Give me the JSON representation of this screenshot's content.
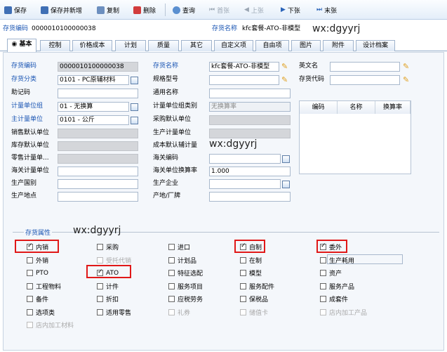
{
  "toolbar": {
    "items": [
      {
        "name": "save-button",
        "label": "保存",
        "icon": "save-icon",
        "enabled": true
      },
      {
        "name": "save-new-button",
        "label": "保存并新增",
        "icon": "save-new-icon",
        "enabled": true
      },
      {
        "name": "copy-button",
        "label": "复制",
        "icon": "copy-icon",
        "enabled": true
      },
      {
        "name": "delete-button",
        "label": "删除",
        "icon": "delete-icon",
        "enabled": true
      },
      {
        "name": "query-button",
        "label": "查询",
        "icon": "query-icon",
        "enabled": true
      },
      {
        "name": "first-button",
        "label": "首张",
        "icon": "first-icon",
        "enabled": false
      },
      {
        "name": "prev-button",
        "label": "上张",
        "icon": "prev-icon",
        "enabled": false
      },
      {
        "name": "next-button",
        "label": "下张",
        "icon": "next-icon",
        "enabled": true
      },
      {
        "name": "last-button",
        "label": "末张",
        "icon": "last-icon",
        "enabled": true
      }
    ]
  },
  "header": {
    "code_label": "存货编码",
    "code_value": "0000010100000038",
    "name_label": "存货名称",
    "name_value": "kfc套餐-ATO-非模型",
    "watermark": "wx:dgyyrj"
  },
  "tabs": [
    "基本",
    "控制",
    "价格成本",
    "计划",
    "质量",
    "其它",
    "自定义项",
    "自由项",
    "图片",
    "附件",
    "设计档案"
  ],
  "form": {
    "labels": {
      "code": "存货编码",
      "category": "存货分类",
      "mnemonic": "助记码",
      "uom_group": "计量单位组",
      "main_uom": "主计量单位",
      "sales_uom": "销售默认单位",
      "stock_uom": "库存默认单位",
      "retail_uom": "零售计量单...",
      "customs_uom": "海关计量单位",
      "origin_country": "生产国别",
      "origin_place": "生产地点",
      "name": "存货名称",
      "spec": "规格型号",
      "common_name": "通用名称",
      "uom_group_type": "计量单位组类别",
      "purchase_uom": "采购默认单位",
      "production_uom": "生产计量单位",
      "cost_uom": "成本默认辅计量",
      "customs_code": "海关编码",
      "customs_rate": "海关单位换算率",
      "manufacturer": "生产企业",
      "origin_brand": "产地/厂牌",
      "english_name": "英文名",
      "item_code": "存货代码"
    },
    "values": {
      "code": "0000010100000038",
      "category": "0101 - PC原辅材料",
      "uom_group": "01 - 无换算",
      "main_uom": "0101 - 公斤",
      "name": "kfc套餐-ATO-非模型",
      "uom_group_type": "无换算率",
      "customs_rate": "1.000"
    }
  },
  "grid": {
    "headers": [
      "编码",
      "名称",
      "换算率"
    ]
  },
  "attributes": {
    "title": "存货属性",
    "watermark": "wx:dgyyrj",
    "rows": [
      [
        {
          "label": "内销",
          "checked": true
        },
        {
          "label": "采购",
          "checked": false
        },
        {
          "label": "进口",
          "checked": false
        },
        {
          "label": "自制",
          "checked": true
        },
        {
          "label": "委外",
          "checked": true
        }
      ],
      [
        {
          "label": "外销",
          "checked": false
        },
        {
          "label": "受托代销",
          "checked": false,
          "disabled": true
        },
        {
          "label": "计划品",
          "checked": false
        },
        {
          "label": "在制",
          "checked": false
        },
        {
          "label": "生产耗用",
          "checked": false
        }
      ],
      [
        {
          "label": "PTO",
          "checked": false
        },
        {
          "label": "ATO",
          "checked": true
        },
        {
          "label": "特征选配",
          "checked": false
        },
        {
          "label": "模型",
          "checked": false
        },
        {
          "label": "资产",
          "checked": false
        }
      ],
      [
        {
          "label": "工程物料",
          "checked": false
        },
        {
          "label": "计件",
          "checked": false
        },
        {
          "label": "服务项目",
          "checked": false
        },
        {
          "label": "服务配件",
          "checked": false
        },
        {
          "label": "服务产品",
          "checked": false
        }
      ],
      [
        {
          "label": "备件",
          "checked": false
        },
        {
          "label": "折扣",
          "checked": false
        },
        {
          "label": "应税劳务",
          "checked": false
        },
        {
          "label": "保税品",
          "checked": false
        },
        {
          "label": "成套件",
          "checked": false
        }
      ],
      [
        {
          "label": "选项类",
          "checked": false
        },
        {
          "label": "适用零售",
          "checked": false
        },
        {
          "label": "礼券",
          "checked": false,
          "disabled": true
        },
        {
          "label": "储值卡",
          "checked": false,
          "disabled": true
        },
        {
          "label": "店内加工产品",
          "checked": false,
          "disabled": true
        }
      ],
      [
        {
          "label": "店内加工材料",
          "checked": false,
          "disabled": true
        }
      ]
    ]
  },
  "colors": {
    "accent": "#1a55b3",
    "highlight": "#e01818"
  }
}
